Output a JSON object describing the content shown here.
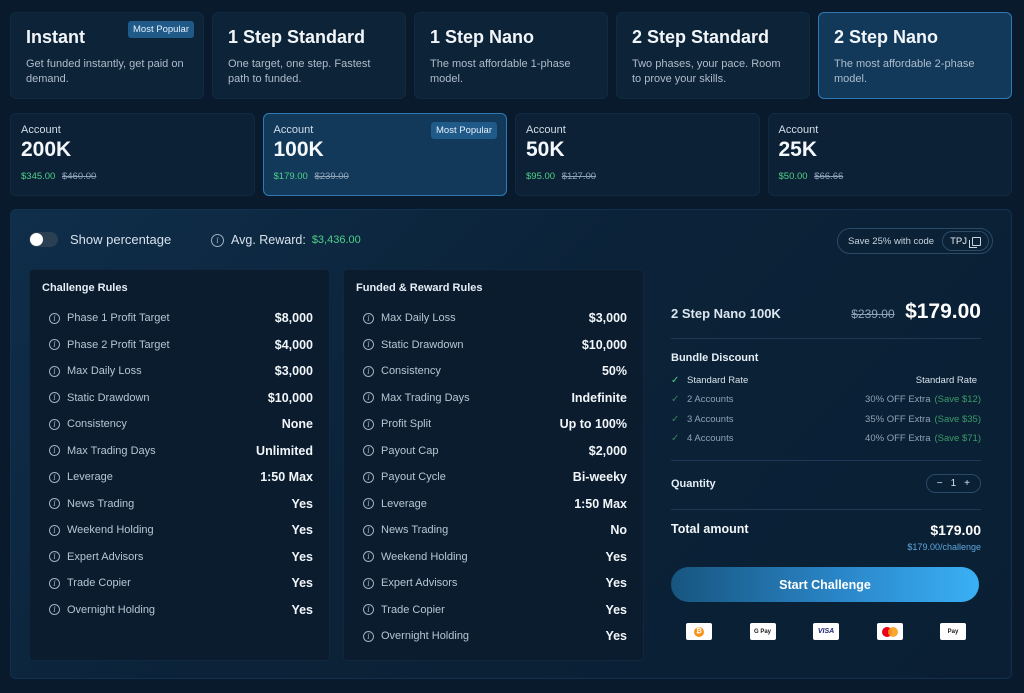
{
  "plans": [
    {
      "title": "Instant",
      "desc": "Get funded instantly, get paid on demand.",
      "badge": "Most Popular",
      "selected": false
    },
    {
      "title": "1 Step Standard",
      "desc": "One target, one step. Fastest path to funded.",
      "badge": "",
      "selected": false
    },
    {
      "title": "1 Step Nano",
      "desc": "The most affordable 1-phase model.",
      "badge": "",
      "selected": false
    },
    {
      "title": "2 Step Standard",
      "desc": "Two phases, your pace. Room to prove your skills.",
      "badge": "",
      "selected": false
    },
    {
      "title": "2 Step Nano",
      "desc": "The most affordable 2-phase model.",
      "badge": "",
      "selected": true
    }
  ],
  "accounts": [
    {
      "label": "Account",
      "size": "200K",
      "price": "$345.00",
      "old_price": "$460.00",
      "badge": "",
      "selected": false
    },
    {
      "label": "Account",
      "size": "100K",
      "price": "$179.00",
      "old_price": "$239.00",
      "badge": "Most Popular",
      "selected": true
    },
    {
      "label": "Account",
      "size": "50K",
      "price": "$95.00",
      "old_price": "$127.00",
      "badge": "",
      "selected": false
    },
    {
      "label": "Account",
      "size": "25K",
      "price": "$50.00",
      "old_price": "$66.66",
      "badge": "",
      "selected": false
    }
  ],
  "controls": {
    "show_percentage_label": "Show percentage",
    "show_percentage_on": false,
    "avg_reward_label": "Avg. Reward:",
    "avg_reward_value": "$3,436.00",
    "code_text": "Save 25% with code",
    "code": "TPJ"
  },
  "challenge_rules": {
    "title": "Challenge Rules",
    "rows": [
      {
        "label": "Phase 1 Profit Target",
        "value": "$8,000"
      },
      {
        "label": "Phase 2 Profit Target",
        "value": "$4,000"
      },
      {
        "label": "Max Daily Loss",
        "value": "$3,000"
      },
      {
        "label": "Static Drawdown",
        "value": "$10,000"
      },
      {
        "label": "Consistency",
        "value": "None"
      },
      {
        "label": "Max Trading Days",
        "value": "Unlimited"
      },
      {
        "label": "Leverage",
        "value": "1:50 Max"
      },
      {
        "label": "News Trading",
        "value": "Yes"
      },
      {
        "label": "Weekend Holding",
        "value": "Yes"
      },
      {
        "label": "Expert Advisors",
        "value": "Yes"
      },
      {
        "label": "Trade Copier",
        "value": "Yes"
      },
      {
        "label": "Overnight Holding",
        "value": "Yes"
      }
    ]
  },
  "funded_rules": {
    "title": "Funded & Reward Rules",
    "rows": [
      {
        "label": "Max Daily Loss",
        "value": "$3,000"
      },
      {
        "label": "Static Drawdown",
        "value": "$10,000"
      },
      {
        "label": "Consistency",
        "value": "50%"
      },
      {
        "label": "Max Trading Days",
        "value": "Indefinite"
      },
      {
        "label": "Profit Split",
        "value": "Up to 100%"
      },
      {
        "label": "Payout Cap",
        "value": "$2,000"
      },
      {
        "label": "Payout Cycle",
        "value": "Bi-weeky"
      },
      {
        "label": "Leverage",
        "value": "1:50 Max"
      },
      {
        "label": "News Trading",
        "value": "No"
      },
      {
        "label": "Weekend Holding",
        "value": "Yes"
      },
      {
        "label": "Expert Advisors",
        "value": "Yes"
      },
      {
        "label": "Trade Copier",
        "value": "Yes"
      },
      {
        "label": "Overnight Holding",
        "value": "Yes"
      }
    ]
  },
  "summary": {
    "plan_name": "2 Step Nano 100K",
    "old_price": "$239.00",
    "price": "$179.00",
    "bundle_title": "Bundle Discount",
    "bundles": [
      {
        "name": "Standard Rate",
        "discount": "Standard Rate",
        "save": "",
        "active": true
      },
      {
        "name": "2 Accounts",
        "discount": "30% OFF Extra",
        "save": "(Save $12)",
        "active": false
      },
      {
        "name": "3 Accounts",
        "discount": "35% OFF Extra",
        "save": "(Save $35)",
        "active": false
      },
      {
        "name": "4 Accounts",
        "discount": "40% OFF Extra",
        "save": "(Save $71)",
        "active": false
      }
    ],
    "quantity_label": "Quantity",
    "quantity": "1",
    "minus": "−",
    "plus": "+",
    "total_label": "Total amount",
    "total": "$179.00",
    "total_per": "$179.00/challenge",
    "start_label": "Start Challenge"
  },
  "payments": [
    {
      "name": "bitcoin-icon",
      "label": "₿"
    },
    {
      "name": "google-pay-icon",
      "label": "G Pay"
    },
    {
      "name": "visa-icon",
      "label": "VISA"
    },
    {
      "name": "mastercard-icon",
      "label": ""
    },
    {
      "name": "apple-pay-icon",
      "label": " Pay"
    }
  ],
  "colors": {
    "background": "#081a2b",
    "accent": "#2a86c8",
    "price_green": "#4fd089",
    "selected_border": "#2f7ab5"
  }
}
